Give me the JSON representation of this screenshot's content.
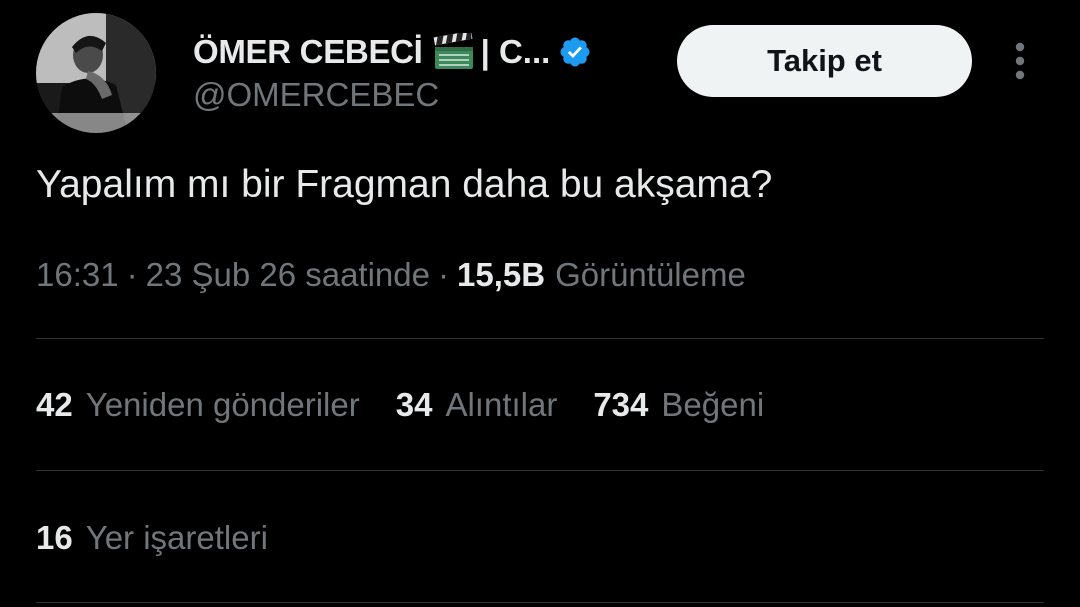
{
  "author": {
    "display_name": "ÖMER CEBECİ",
    "name_tail": "| C...",
    "handle": "@OMERCEBEC",
    "clapper_icon": "clapperboard-emoji-icon",
    "verified_icon": "verified-badge-icon",
    "verified_color": "#1d9bf0"
  },
  "follow_button": {
    "label": "Takip et"
  },
  "more_icon": "more-vertical-icon",
  "tweet": {
    "text": "Yapalım mı bir Fragman daha bu akşama?",
    "time": "16:31",
    "separator": "·",
    "date": "23 Şub 26 saatinde",
    "views_count": "15,5B",
    "views_label": "Görüntüleme"
  },
  "stats": {
    "reposts_count": "42",
    "reposts_label": "Yeniden gönderiler",
    "quotes_count": "34",
    "quotes_label": "Alıntılar",
    "likes_count": "734",
    "likes_label": "Beğeni",
    "bookmarks_count": "16",
    "bookmarks_label": "Yer işaretleri"
  },
  "colors": {
    "background": "#000000",
    "text_primary": "#e7e9ea",
    "text_secondary": "#71767b",
    "divider": "#2f3336",
    "button_bg": "#eff3f4",
    "button_text": "#0f1419"
  }
}
